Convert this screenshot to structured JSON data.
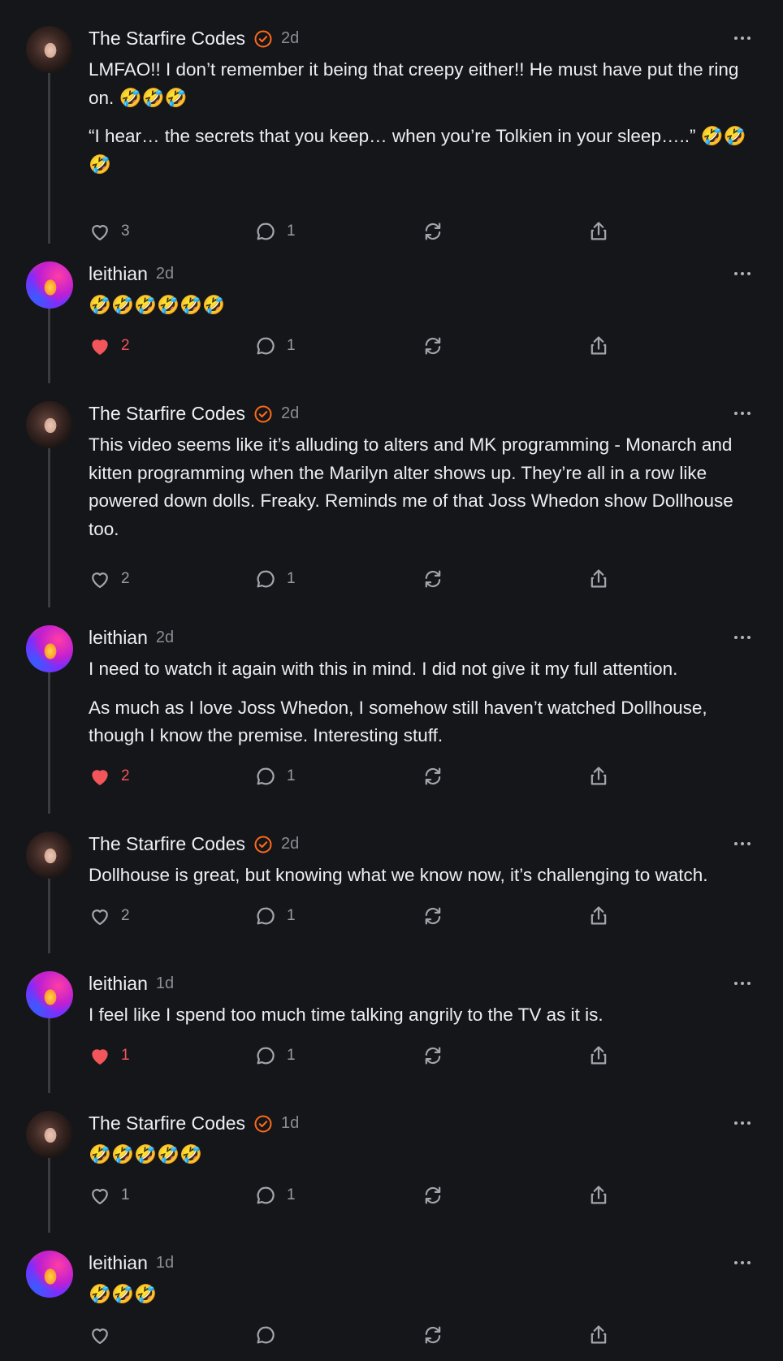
{
  "comments": [
    {
      "author": "The Starfire Codes",
      "verified": true,
      "time": "2d",
      "paragraphs": [
        "LMFAO!! I don’t remember it being that creepy either!! He must have put the ring on. 🤣🤣🤣",
        "“I hear… the secrets that you keep… when you’re Tolkien in your sleep…..” 🤣🤣🤣"
      ],
      "likes": "3",
      "liked": false,
      "replies": "1"
    },
    {
      "author": "leithian",
      "verified": false,
      "time": "2d",
      "paragraphs": [
        "🤣🤣🤣🤣🤣🤣"
      ],
      "likes": "2",
      "liked": true,
      "replies": "1"
    },
    {
      "author": "The Starfire Codes",
      "verified": true,
      "time": "2d",
      "paragraphs": [
        "This video seems like it’s alluding to alters and MK programming - Monarch and kitten programming when the Marilyn alter shows up. They’re all in a row like powered down dolls. Freaky. Reminds me of that Joss Whedon show Dollhouse too."
      ],
      "likes": "2",
      "liked": false,
      "replies": "1"
    },
    {
      "author": "leithian",
      "verified": false,
      "time": "2d",
      "paragraphs": [
        "I need to watch it again with this in mind. I did not give it my full attention.",
        "As much as I love Joss Whedon, I somehow still haven’t watched Dollhouse, though I know the premise. Interesting stuff."
      ],
      "likes": "2",
      "liked": true,
      "replies": "1"
    },
    {
      "author": "The Starfire Codes",
      "verified": true,
      "time": "2d",
      "paragraphs": [
        "Dollhouse is great, but knowing what we know now, it’s challenging to watch."
      ],
      "likes": "2",
      "liked": false,
      "replies": "1"
    },
    {
      "author": "leithian",
      "verified": false,
      "time": "1d",
      "paragraphs": [
        "I feel like I spend too much time talking angrily to the TV as it is."
      ],
      "likes": "1",
      "liked": true,
      "replies": "1"
    },
    {
      "author": "The Starfire Codes",
      "verified": true,
      "time": "1d",
      "paragraphs": [
        "🤣🤣🤣🤣🤣"
      ],
      "likes": "1",
      "liked": false,
      "replies": "1"
    },
    {
      "author": "leithian",
      "verified": false,
      "time": "1d",
      "paragraphs": [
        "🤣🤣🤣"
      ],
      "likes": "",
      "liked": false,
      "replies": ""
    }
  ],
  "icons": {
    "like": "heart-icon",
    "reply": "comment-bubble-icon",
    "repost": "repost-icon",
    "share": "share-icon",
    "more": "more-options-icon",
    "verified": "verified-badge-icon"
  },
  "colors": {
    "background": "#151619",
    "accent_verified": "#ff6a1a",
    "liked": "#f2555a",
    "muted": "#8a8d93"
  }
}
